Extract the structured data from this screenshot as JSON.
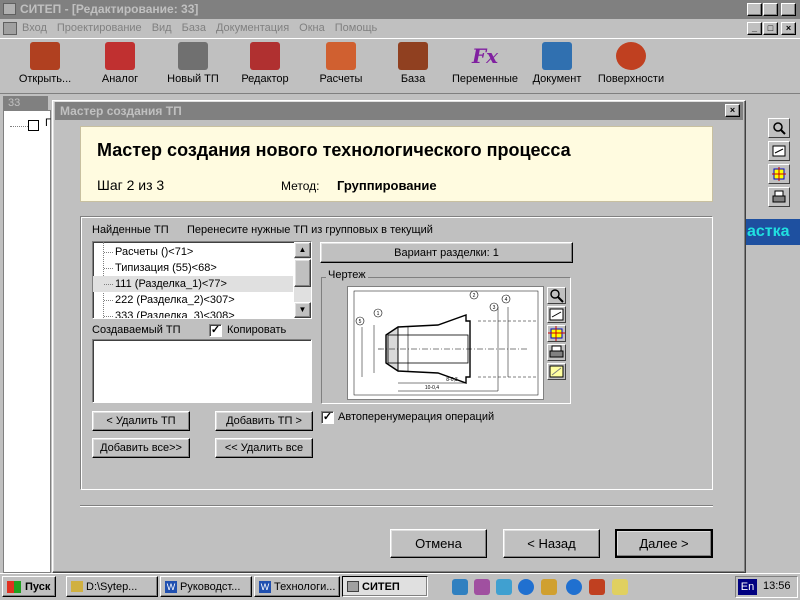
{
  "app": {
    "title": "СИТЕП - [Редактирование: 33]"
  },
  "menu": [
    "Вход",
    "Проектирование",
    "Вид",
    "База",
    "Документация",
    "Окна",
    "Помощь"
  ],
  "toolbar": [
    {
      "label": "Открыть...",
      "icon": "open-icon",
      "color": "#b04020"
    },
    {
      "label": "Аналог",
      "icon": "analog-icon",
      "color": "#c03030"
    },
    {
      "label": "Новый ТП",
      "icon": "new-tp-icon",
      "color": "#606060"
    },
    {
      "label": "Редактор",
      "icon": "editor-icon",
      "color": "#b03030"
    },
    {
      "label": "Расчеты",
      "icon": "calculator-icon",
      "color": "#d06030"
    },
    {
      "label": "База",
      "icon": "database-icon",
      "color": "#904020"
    },
    {
      "label": "Переменные",
      "icon": "fx-icon",
      "color": "#8020a0"
    },
    {
      "label": "Документ",
      "icon": "document-icon",
      "color": "#3070b0"
    },
    {
      "label": "Поверхности",
      "icon": "surfaces-icon",
      "color": "#c04020"
    }
  ],
  "child_window": {
    "caption": "33",
    "tree_label": "Г",
    "side_text": "астка"
  },
  "dialog": {
    "title": "Мастер создания ТП",
    "header_title": "Мастер создания нового технологического процесса",
    "step": "Шаг 2 из 3",
    "method_label": "Метод:",
    "method_value": "Группирование",
    "found_label": "Найденные ТП",
    "instruction": "Перенесите нужные ТП из групповых  в текущий",
    "found_list": [
      "Расчеты ()<71>",
      "Типизация (55)<68>",
      "111 (Разделка_1)<77>",
      "222 (Разделка_2)<307>",
      "333 (Разделка_3)<308>"
    ],
    "selected_index": 2,
    "variant_button": "Вариант разделки: 1",
    "drawing_label": "Чертеж",
    "created_label": "Создаваемый ТП",
    "copy_label": "Копировать",
    "copy_checked": true,
    "remove_tp": "< Удалить ТП",
    "add_tp": "Добавить ТП >",
    "add_all": "Добавить все>>",
    "remove_all": "<< Удалить все",
    "autorenum_label": "Автоперенумерация операций",
    "autorenum_checked": true,
    "cancel": "Отмена",
    "back": "< Назад",
    "next": "Далее >",
    "drawing_text": {
      "tag1": "1",
      "tag2": "2",
      "tag3": "3",
      "tag4": "4",
      "tag5": "5",
      "dim1": "8-0,3",
      "dim2": "10-0,4"
    }
  },
  "taskbar": {
    "start": "Пуск",
    "items": [
      "D:\\Sytep...",
      "Руководст...",
      "Технологи...",
      "СИТЕП"
    ],
    "active_index": 3,
    "lang": "En",
    "clock": "13:56"
  }
}
